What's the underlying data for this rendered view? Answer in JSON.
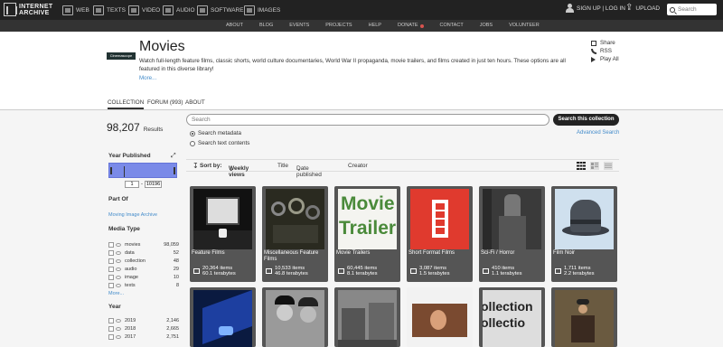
{
  "topnav": {
    "logo": "INTERNET ARCHIVE",
    "items": [
      {
        "label": "WEB",
        "icon": "web-icon"
      },
      {
        "label": "TEXTS",
        "icon": "texts-icon"
      },
      {
        "label": "VIDEO",
        "icon": "video-icon"
      },
      {
        "label": "AUDIO",
        "icon": "audio-icon"
      },
      {
        "label": "SOFTWARE",
        "icon": "software-icon"
      },
      {
        "label": "IMAGES",
        "icon": "images-icon"
      }
    ],
    "signup": "SIGN UP | LOG IN",
    "upload": "UPLOAD",
    "search_placeholder": "Search"
  },
  "subnav": [
    "ABOUT",
    "BLOG",
    "EVENTS",
    "PROJECTS",
    "HELP",
    "DONATE",
    "CONTACT",
    "JOBS",
    "VOLUNTEER"
  ],
  "header": {
    "thumb": "Cinemascope",
    "title": "Movies",
    "description": "Watch full-length feature films, classic shorts, world culture documentaries, World War II propaganda, movie trailers, and films created in just ten hours. These options are all featured in this diverse library!",
    "more": "More...",
    "share": "Share",
    "rss": "RSS",
    "play_all": "Play All"
  },
  "tabs": {
    "collection": "COLLECTION",
    "forum": "FORUM (993)",
    "about": "ABOUT"
  },
  "results": {
    "count": "98,207",
    "label": "Results"
  },
  "filters": {
    "year_published": "Year Published",
    "year_from": "1",
    "year_to": "10196",
    "part_of": "Part Of",
    "part_of_link": "Moving Image Archive",
    "media_type": "Media Type",
    "media": [
      {
        "label": "movies",
        "count": "98,059"
      },
      {
        "label": "data",
        "count": "52"
      },
      {
        "label": "collection",
        "count": "48"
      },
      {
        "label": "audio",
        "count": "29"
      },
      {
        "label": "image",
        "count": "10"
      },
      {
        "label": "texts",
        "count": "8"
      }
    ],
    "more": "More...",
    "year": "Year",
    "years": [
      {
        "label": "2019",
        "count": "2,146"
      },
      {
        "label": "2018",
        "count": "2,665"
      },
      {
        "label": "2017",
        "count": "2,751"
      }
    ]
  },
  "search": {
    "placeholder": "Search",
    "button": "Search this collection",
    "metadata": "Search metadata",
    "text_contents": "Search text contents",
    "advanced": "Advanced Search"
  },
  "sort": {
    "label": "Sort by:",
    "weekly": "Weekly views",
    "title": "Title",
    "date": "Date published",
    "creator": "Creator"
  },
  "cards": [
    {
      "title": "Feature Films",
      "items": "20,364 items",
      "size": "60.1 terabytes"
    },
    {
      "title": "Miscellaneous Feature Films",
      "items": "10,533 items",
      "size": "46.8 terabytes"
    },
    {
      "title": "Movie Trailers",
      "items": "60,445 items",
      "size": "8.1 terabytes"
    },
    {
      "title": "Short Format Films",
      "items": "3,087 items",
      "size": "1.5 terabytes"
    },
    {
      "title": "Sci-Fi / Horror",
      "items": "410 items",
      "size": "1.1 terabytes"
    },
    {
      "title": "Film Noir",
      "items": "1,711 items",
      "size": "2.2 terabytes"
    }
  ],
  "trailer_text": [
    "Movie",
    "Trailers"
  ],
  "collection_text": [
    "ollection",
    "ollectio"
  ]
}
